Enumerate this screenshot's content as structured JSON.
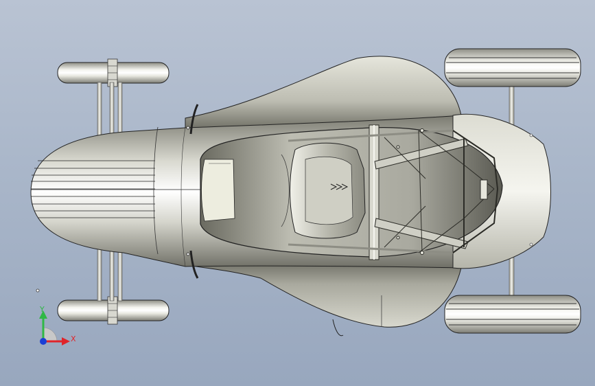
{
  "viewport": {
    "background_top": "#b9c3d3",
    "background_bottom": "#98a7be",
    "model_icon": "race-car-model-top-view"
  },
  "triad": {
    "x_label": "X",
    "y_label": "Y",
    "x_color": "#e0242a",
    "y_color": "#2fb845",
    "z_color": "#1a3fd6"
  }
}
